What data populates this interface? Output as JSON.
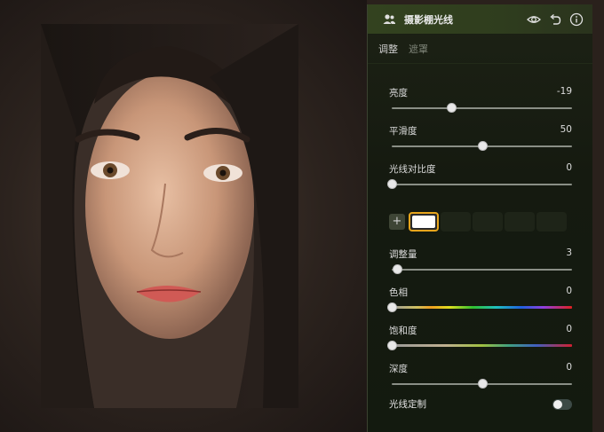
{
  "panel": {
    "title": "摄影棚光线",
    "tabs": [
      {
        "label": "调整",
        "active": true
      },
      {
        "label": "遮罩",
        "active": false
      }
    ],
    "icons": [
      "people-icon",
      "eye-icon",
      "undo-icon",
      "info-icon"
    ]
  },
  "controls": {
    "brightness": {
      "label": "亮度",
      "value": "-19",
      "level": 0.33
    },
    "smoothness": {
      "label": "平滑度",
      "value": "50",
      "level": 0.5
    },
    "light_contrast": {
      "label": "光线对比度",
      "value": "0",
      "level": 0.0
    }
  },
  "light": {
    "amount": {
      "label": "调整量",
      "value": "3",
      "level": 0.03
    },
    "hue": {
      "label": "色相",
      "value": "0",
      "level": 0.0
    },
    "saturation": {
      "label": "饱和度",
      "value": "0",
      "level": 0.0
    },
    "depth": {
      "label": "深度",
      "value": "0",
      "level": 0.5
    }
  },
  "swatches": {
    "add_label": "+",
    "selected_color": "#ffffff",
    "count": 6
  },
  "custom_light": {
    "label": "光线定制",
    "enabled": false
  },
  "colors": {
    "accent": "#e7a51c",
    "panel_header": "#33421f"
  }
}
